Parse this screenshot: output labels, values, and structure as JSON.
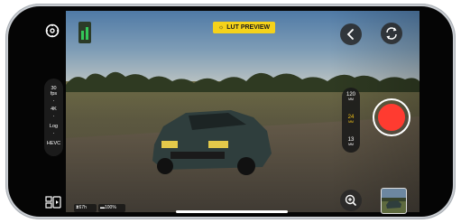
{
  "app": {
    "name": "Camera viewfinder"
  },
  "top": {
    "lut_badge": "LUT PREVIEW"
  },
  "format": {
    "fps_value": "30",
    "fps_unit": "fps",
    "resolution": "4K",
    "profile": "Log",
    "codec": "HEVC"
  },
  "lenses": [
    {
      "focal": "120",
      "unit": "MM"
    },
    {
      "focal": "24",
      "unit": "MM",
      "active": true
    },
    {
      "focal": "13",
      "unit": "MM"
    }
  ],
  "status": {
    "time_remaining": "67h",
    "battery": "100%"
  },
  "colors": {
    "accent": "#f5c518",
    "record": "#ff3b30",
    "level": "#34c759",
    "lut_bg": "#f5d21a"
  },
  "icons": [
    "settings-icon",
    "level-meter-icon",
    "back-icon",
    "flip-camera-icon",
    "record-icon",
    "gallery-icon",
    "zoom-in-icon",
    "hourglass-icon",
    "battery-icon"
  ]
}
